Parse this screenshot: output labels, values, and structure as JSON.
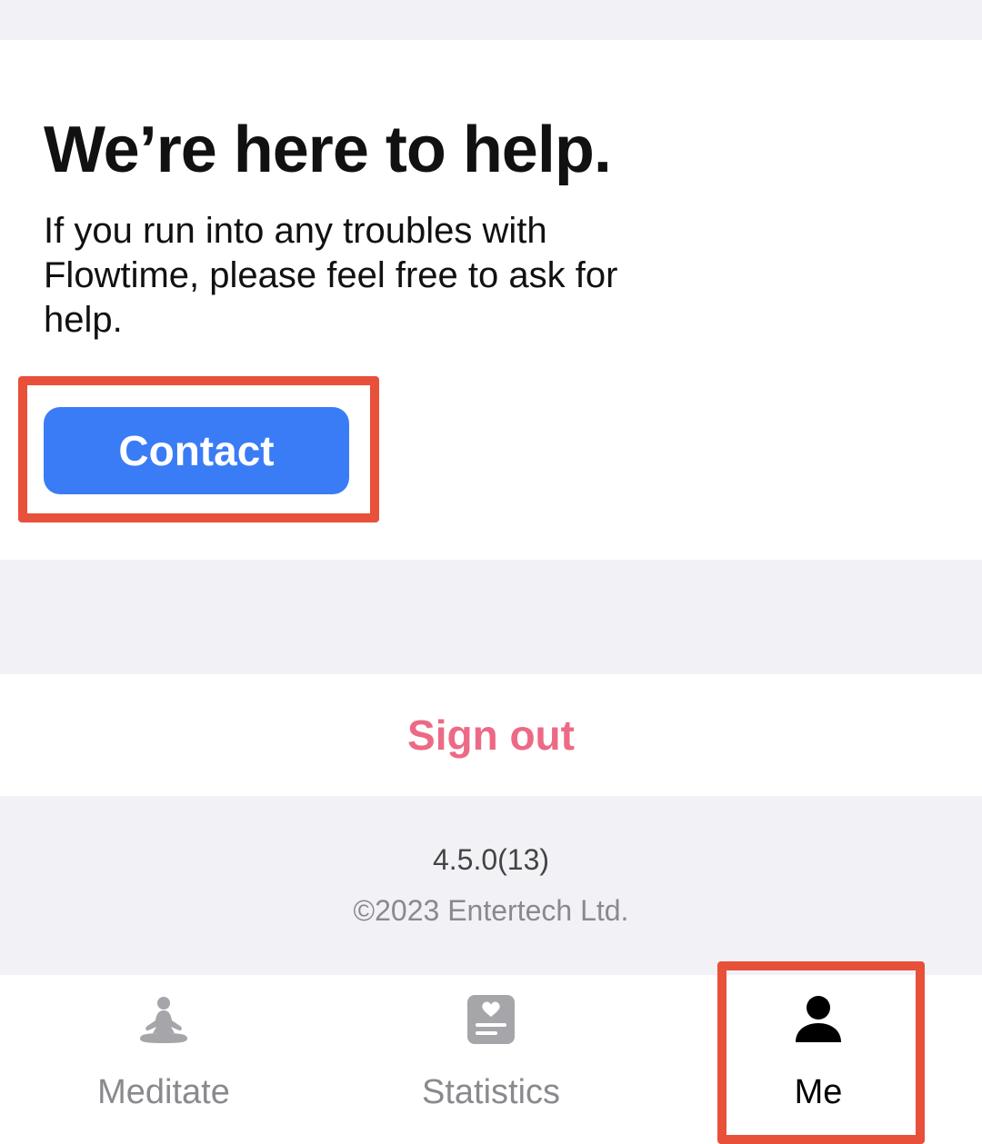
{
  "help": {
    "title": "We’re here to help.",
    "body": "If you run into any troubles with Flowtime, please feel free to ask for help.",
    "contact_label": "Contact"
  },
  "account": {
    "signout_label": "Sign out"
  },
  "footer": {
    "version": "4.5.0(13)",
    "copyright": "©2023 Entertech Ltd."
  },
  "tabbar": {
    "items": [
      {
        "label": "Meditate",
        "icon": "meditate-icon",
        "active": false
      },
      {
        "label": "Statistics",
        "icon": "statistics-icon",
        "active": false
      },
      {
        "label": "Me",
        "icon": "person-icon",
        "active": true
      }
    ]
  },
  "colors": {
    "accent_blue": "#3a7cf5",
    "signout_pink": "#ec6a86",
    "highlight_red": "#e8503a",
    "background": "#f2f2f6"
  }
}
